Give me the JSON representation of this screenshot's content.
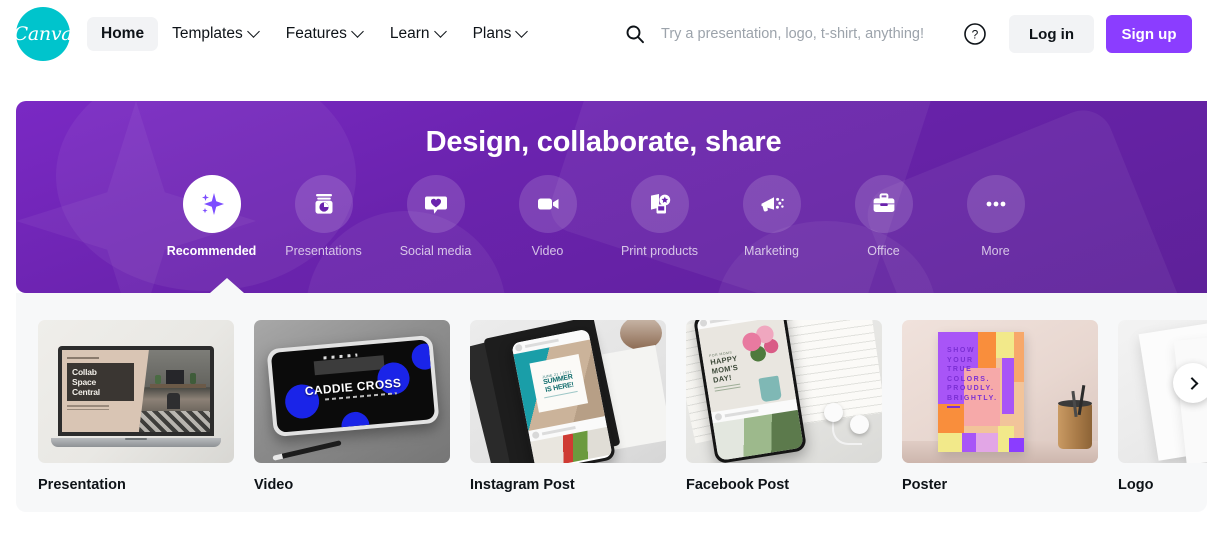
{
  "header": {
    "logo_text": "Canva",
    "nav": [
      {
        "label": "Home",
        "has_caret": false,
        "active": true
      },
      {
        "label": "Templates",
        "has_caret": true,
        "active": false
      },
      {
        "label": "Features",
        "has_caret": true,
        "active": false
      },
      {
        "label": "Learn",
        "has_caret": true,
        "active": false
      },
      {
        "label": "Plans",
        "has_caret": true,
        "active": false
      }
    ],
    "search": {
      "placeholder": "Try a presentation, logo, t-shirt, anything!",
      "value": ""
    },
    "help_label": "?",
    "login_label": "Log in",
    "signup_label": "Sign up",
    "signup_color": "#8b3dff"
  },
  "hero": {
    "title": "Design, collaborate, share",
    "background_color": "#6a23ad",
    "categories": [
      {
        "label": "Recommended",
        "icon": "sparkle-icon",
        "selected": true
      },
      {
        "label": "Presentations",
        "icon": "presentation-icon",
        "selected": false
      },
      {
        "label": "Social media",
        "icon": "heart-bubble-icon",
        "selected": false
      },
      {
        "label": "Video",
        "icon": "video-camera-icon",
        "selected": false
      },
      {
        "label": "Print products",
        "icon": "print-products-icon",
        "selected": false
      },
      {
        "label": "Marketing",
        "icon": "megaphone-icon",
        "selected": false
      },
      {
        "label": "Office",
        "icon": "briefcase-icon",
        "selected": false
      },
      {
        "label": "More",
        "icon": "ellipsis-icon",
        "selected": false
      }
    ]
  },
  "cards": [
    {
      "label": "Presentation",
      "art": {
        "slide_title_lines": [
          "Collab",
          "Space",
          "Central"
        ]
      }
    },
    {
      "label": "Video",
      "art": {
        "screen_title": "CADDIE CROSS"
      }
    },
    {
      "label": "Instagram Post",
      "art": {
        "kicker": "JUNE 21 / 2021",
        "headline_lines": [
          "SUMMER",
          "IS HERE!"
        ]
      }
    },
    {
      "label": "Facebook Post",
      "art": {
        "kicker": "FOR MOMS",
        "headline_lines": [
          "HAPPY",
          "MOM'S",
          "DAY!"
        ]
      }
    },
    {
      "label": "Poster",
      "art": {
        "headline_lines": [
          "SHOW",
          "YOUR",
          "TRUE",
          "COLORS.",
          "PROUDLY.",
          "BRIGHTLY."
        ]
      }
    },
    {
      "label": "Logo",
      "art": {}
    }
  ],
  "carousel": {
    "next_label": "›"
  }
}
